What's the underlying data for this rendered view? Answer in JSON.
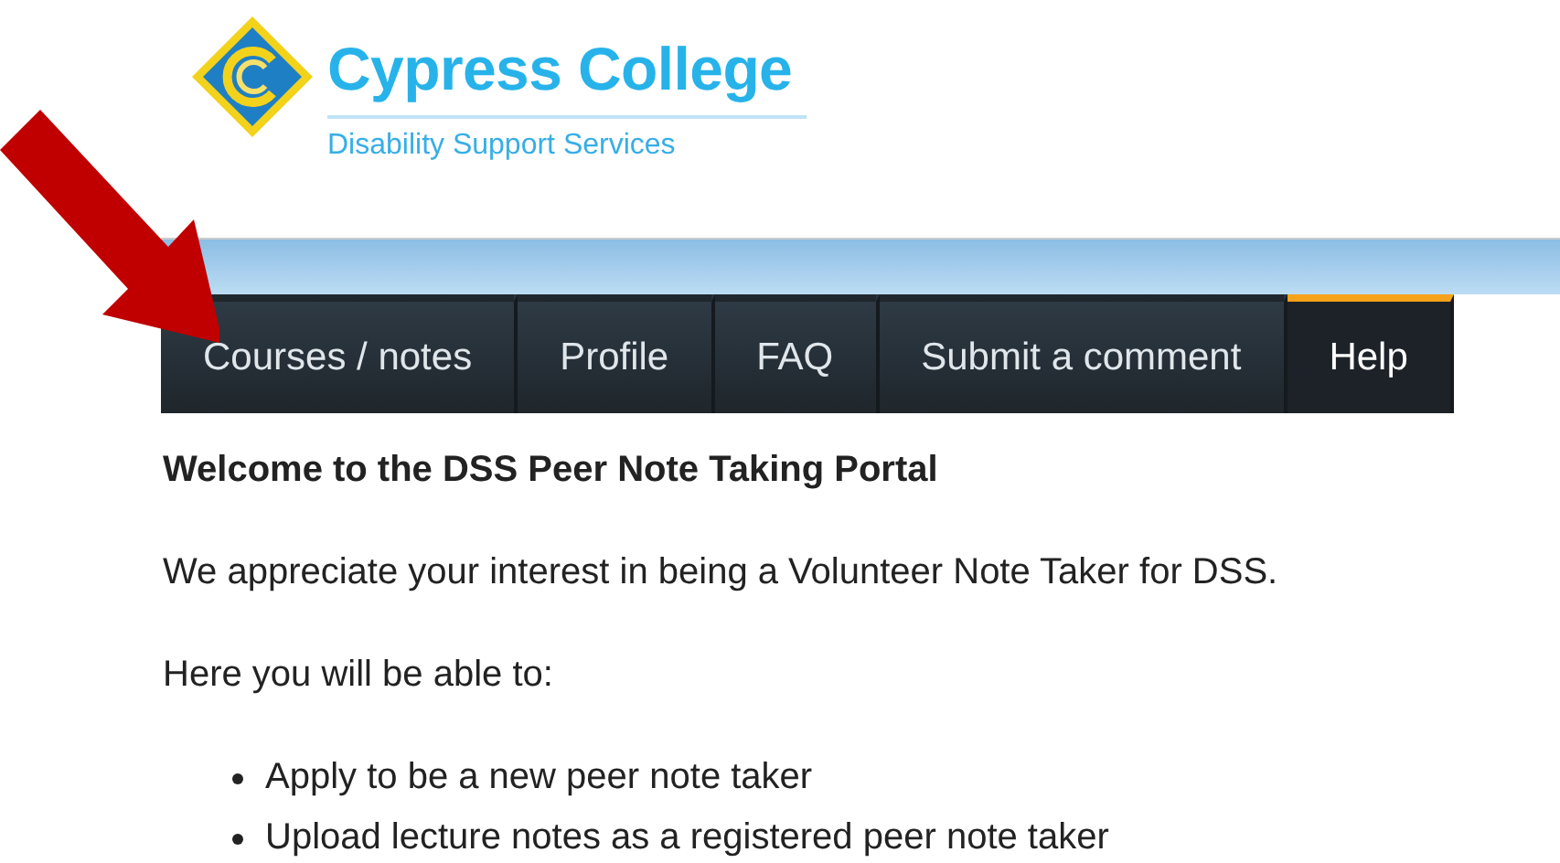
{
  "header": {
    "title": "Cypress College",
    "subtitle": "Disability Support Services"
  },
  "tabs": [
    {
      "label": "Courses / notes",
      "selected": false
    },
    {
      "label": "Profile",
      "selected": false
    },
    {
      "label": "FAQ",
      "selected": false
    },
    {
      "label": "Submit a comment",
      "selected": false
    },
    {
      "label": "Help",
      "selected": true
    }
  ],
  "content": {
    "heading": "Welcome to the DSS Peer Note Taking Portal",
    "paragraphs": [
      "We appreciate your interest in being a Volunteer Note Taker for DSS.",
      "Here you will be able to:"
    ],
    "bullets": [
      "Apply to be a new peer note taker",
      "Upload lecture notes as a registered peer note taker"
    ]
  }
}
